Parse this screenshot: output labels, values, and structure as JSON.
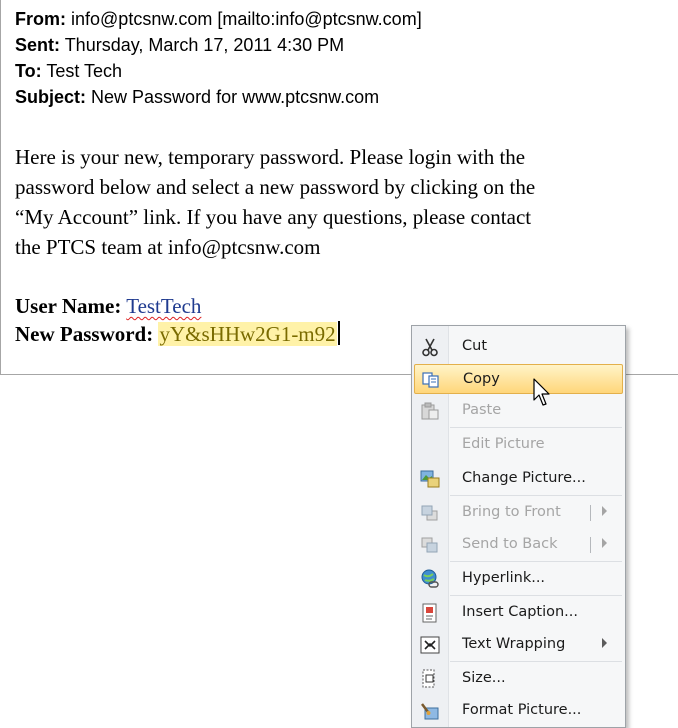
{
  "email": {
    "from_label": "From:",
    "from_value": "info@ptcsnw.com [mailto:info@ptcsnw.com]",
    "sent_label": "Sent:",
    "sent_value": "Thursday, March 17, 2011 4:30 PM",
    "to_label": "To:",
    "to_value": "Test Tech",
    "subject_label": "Subject:",
    "subject_value": "New Password for www.ptcsnw.com",
    "body_line1": "Here is your new, temporary password. Please login with the",
    "body_line2": "password below and select a new password by clicking on the",
    "body_line3": "“My Account” link. If you have any questions, please contact",
    "body_line4": "the PTCS team at info@ptcsnw.com",
    "username_label": "User Name:",
    "username_value": "TestTech",
    "password_label": "New Password:",
    "password_value": "yY&sHHw2G1-m92"
  },
  "context_menu": {
    "items": [
      {
        "label": "Cut",
        "icon": "scissors-icon",
        "enabled": true
      },
      {
        "label": "Copy",
        "icon": "copy-icon",
        "enabled": true,
        "highlighted": true
      },
      {
        "label": "Paste",
        "icon": "paste-icon",
        "enabled": false
      },
      {
        "label": "Edit Picture",
        "icon": "",
        "enabled": false
      },
      {
        "label": "Change Picture...",
        "icon": "change-picture-icon",
        "enabled": true
      },
      {
        "label": "Bring to Front",
        "icon": "bring-to-front-icon",
        "enabled": false,
        "submenu": true
      },
      {
        "label": "Send to Back",
        "icon": "send-to-back-icon",
        "enabled": false,
        "submenu": true
      },
      {
        "label": "Hyperlink...",
        "icon": "hyperlink-icon",
        "enabled": true
      },
      {
        "label": "Insert Caption...",
        "icon": "insert-caption-icon",
        "enabled": true
      },
      {
        "label": "Text Wrapping",
        "icon": "text-wrapping-icon",
        "enabled": true,
        "submenu": true
      },
      {
        "label": "Size...",
        "icon": "size-icon",
        "enabled": true
      },
      {
        "label": "Format Picture...",
        "icon": "format-picture-icon",
        "enabled": true
      }
    ]
  },
  "colors": {
    "highlight_bg": "#fff2a8",
    "menu_hover": "#ffd67a",
    "link_text": "#1f3a8f"
  }
}
